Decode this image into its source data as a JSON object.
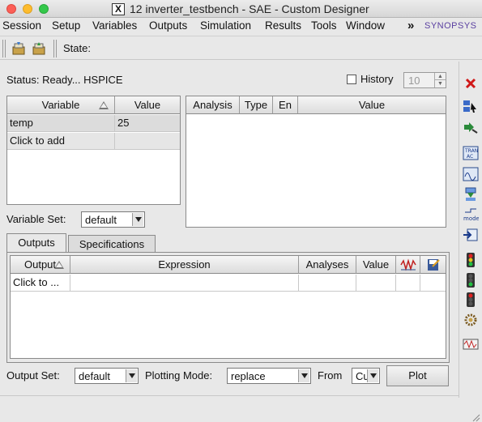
{
  "window": {
    "title": "12 inverter_testbench - SAE - Custom Designer",
    "app_icon": "X"
  },
  "menu": [
    "Session",
    "Setup",
    "Variables",
    "Outputs",
    "Simulation",
    "Results",
    "Tools",
    "Window"
  ],
  "menu_overflow": "»",
  "logo": "SYNOPSYS",
  "toolbar": {
    "state_label": "State:"
  },
  "status": {
    "text": "Status: Ready... HSPICE",
    "history_label": "History",
    "history_checked": false,
    "history_value": "10"
  },
  "variables_table": {
    "headers": [
      "Variable",
      "Value"
    ],
    "rows": [
      {
        "variable": "temp",
        "value": "25"
      },
      {
        "variable": "Click to add",
        "value": ""
      }
    ]
  },
  "analysis_table": {
    "headers": [
      "Analysis",
      "Type",
      "En",
      "Value"
    ]
  },
  "variable_set": {
    "label": "Variable Set:",
    "value": "default"
  },
  "tabs": [
    {
      "label": "Outputs",
      "active": true
    },
    {
      "label": "Specifications",
      "active": false
    }
  ],
  "outputs_table": {
    "headers": [
      "Output",
      "Expression",
      "Analyses",
      "Value",
      "wave-icon",
      "save-icon"
    ],
    "rows": [
      {
        "output": "Click to ...",
        "expression": "",
        "analyses": "",
        "value": ""
      }
    ]
  },
  "footer": {
    "output_set_label": "Output Set:",
    "output_set_value": "default",
    "plotting_mode_label": "Plotting Mode:",
    "plotting_mode_value": "replace",
    "from_label": "From",
    "from_value": "Cu",
    "plot_button": "Plot"
  },
  "right_toolbar_icons": [
    "close-icon",
    "select-icon",
    "run-icon",
    "tran-ac-icon",
    "sweep-icon",
    "download-icon",
    "model-icon",
    "import-icon",
    "traffic-light-icon",
    "traffic-light-green-icon",
    "traffic-light-red-icon",
    "gear-icon",
    "waveform-icon"
  ]
}
